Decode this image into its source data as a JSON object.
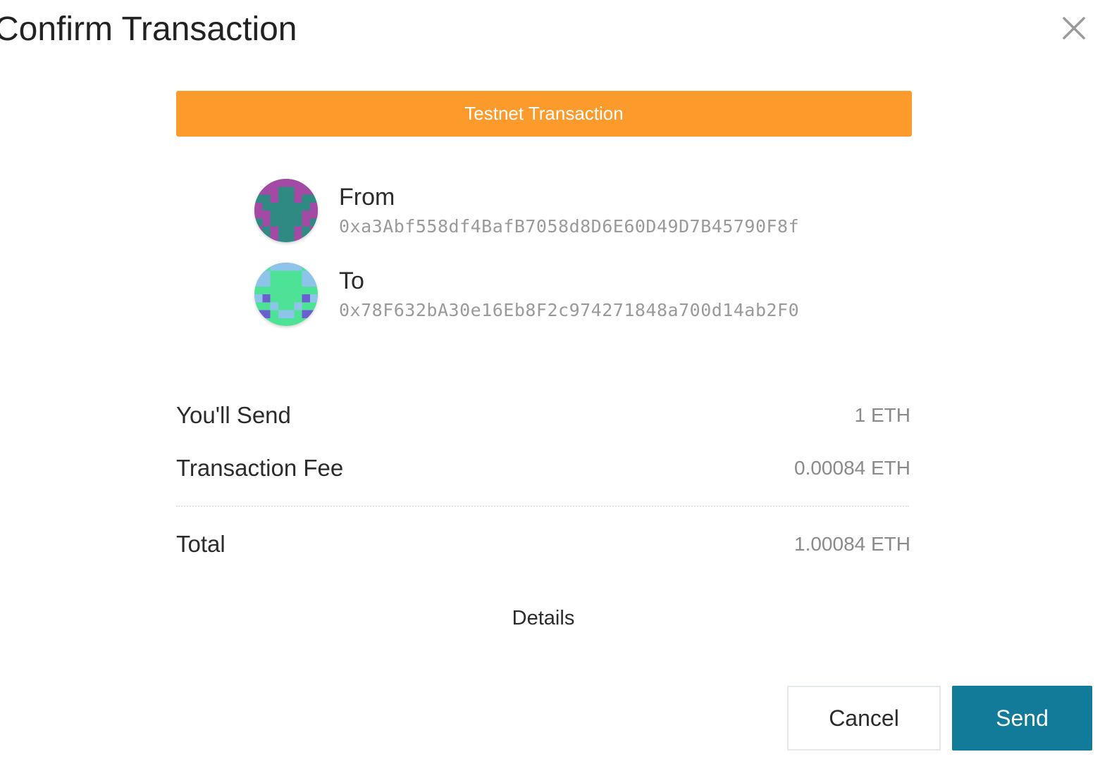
{
  "dialog": {
    "title": "Confirm Transaction"
  },
  "banner": {
    "text": "Testnet Transaction",
    "color": "#fd9a2c"
  },
  "from": {
    "label": "From",
    "address": "0xa3Abf558df4BafB7058d8D6E60D49D7B45790F8f",
    "icon": "identicon"
  },
  "to": {
    "label": "To",
    "address": "0x78F632bA30e16Eb8F2c974271848a700d14ab2F0",
    "icon": "identicon"
  },
  "summary": {
    "send_label": "You'll Send",
    "send_value": "1 ETH",
    "fee_label": "Transaction Fee",
    "fee_value": "0.00084 ETH",
    "total_label": "Total",
    "total_value": "1.00084 ETH"
  },
  "details_label": "Details",
  "actions": {
    "cancel_label": "Cancel",
    "send_label": "Send",
    "send_color": "#127b99"
  }
}
